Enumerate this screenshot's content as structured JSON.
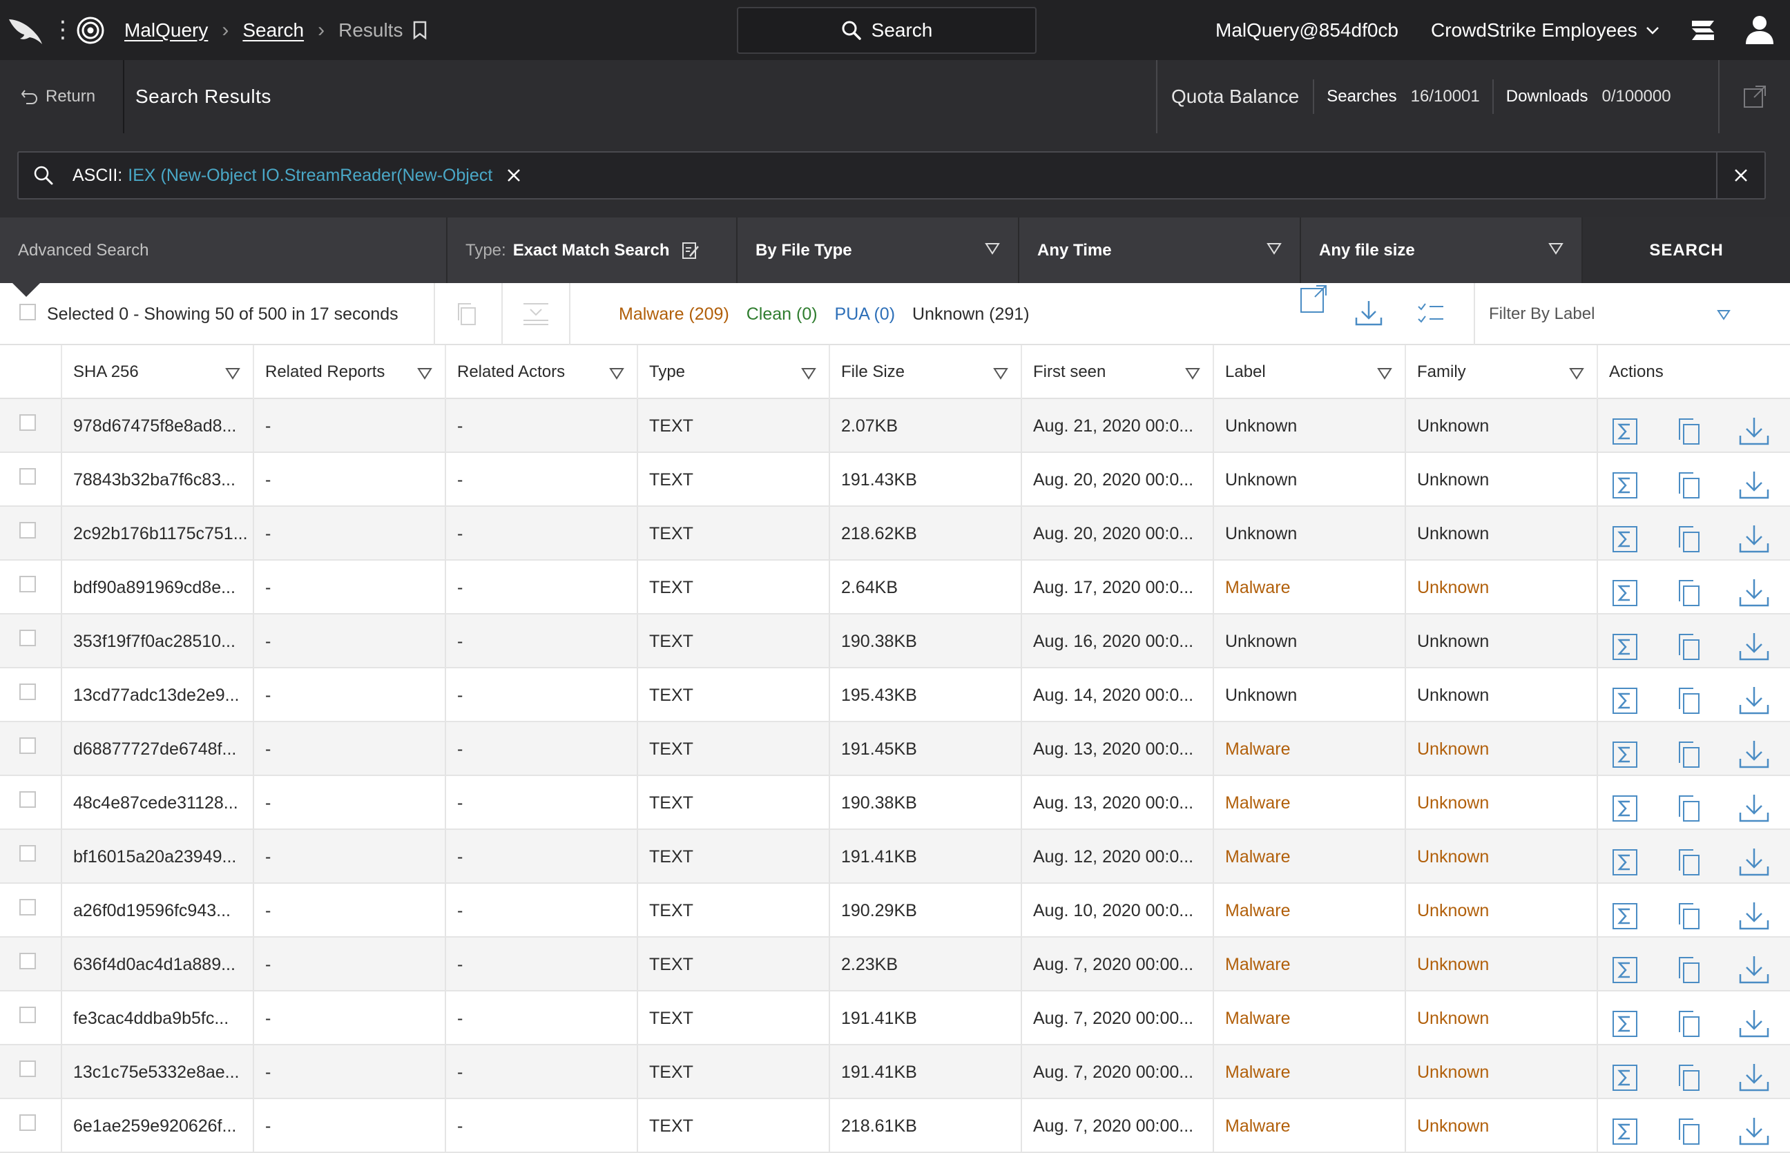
{
  "topbar": {
    "crumbs": [
      "MalQuery",
      "Search",
      "Results"
    ],
    "search_label": "Search",
    "user": "MalQuery@854df0cb",
    "org": "CrowdStrike Employees"
  },
  "subbar": {
    "return_label": "Return",
    "title": "Search Results",
    "quota_label": "Quota Balance",
    "searches_label": "Searches",
    "searches_value": "16/10001",
    "downloads_label": "Downloads",
    "downloads_value": "0/100000"
  },
  "query": {
    "prefix": "ASCII:",
    "value": "IEX (New-Object IO.StreamReader(New-Object"
  },
  "filters": {
    "advanced": "Advanced Search",
    "type_label": "Type:",
    "type_value": "Exact Match Search",
    "file_type": "By File Type",
    "time": "Any Time",
    "size": "Any file size",
    "search_button": "SEARCH"
  },
  "status": {
    "summary": "Selected 0 - Showing 50 of 500 in 17 seconds",
    "malware": "Malware (209)",
    "clean": "Clean (0)",
    "pua": "PUA (0)",
    "unknown": "Unknown (291)",
    "filter_label": "Filter By Label"
  },
  "columns": [
    "SHA 256",
    "Related Reports",
    "Related Actors",
    "Type",
    "File Size",
    "First seen",
    "Label",
    "Family",
    "Actions"
  ],
  "rows": [
    {
      "sha": "978d67475f8e8ad8...",
      "reports": "-",
      "actors": "-",
      "type": "TEXT",
      "size": "2.07KB",
      "seen": "Aug. 21, 2020 00:0...",
      "label": "Unknown",
      "family": "Unknown",
      "malware": false
    },
    {
      "sha": "78843b32ba7f6c83...",
      "reports": "-",
      "actors": "-",
      "type": "TEXT",
      "size": "191.43KB",
      "seen": "Aug. 20, 2020 00:0...",
      "label": "Unknown",
      "family": "Unknown",
      "malware": false
    },
    {
      "sha": "2c92b176b1175c751...",
      "reports": "-",
      "actors": "-",
      "type": "TEXT",
      "size": "218.62KB",
      "seen": "Aug. 20, 2020 00:0...",
      "label": "Unknown",
      "family": "Unknown",
      "malware": false
    },
    {
      "sha": "bdf90a891969cd8e...",
      "reports": "-",
      "actors": "-",
      "type": "TEXT",
      "size": "2.64KB",
      "seen": "Aug. 17, 2020 00:0...",
      "label": "Malware",
      "family": "Unknown",
      "malware": true
    },
    {
      "sha": "353f19f7f0ac28510...",
      "reports": "-",
      "actors": "-",
      "type": "TEXT",
      "size": "190.38KB",
      "seen": "Aug. 16, 2020 00:0...",
      "label": "Unknown",
      "family": "Unknown",
      "malware": false
    },
    {
      "sha": "13cd77adc13de2e9...",
      "reports": "-",
      "actors": "-",
      "type": "TEXT",
      "size": "195.43KB",
      "seen": "Aug. 14, 2020 00:0...",
      "label": "Unknown",
      "family": "Unknown",
      "malware": false
    },
    {
      "sha": "d68877727de6748f...",
      "reports": "-",
      "actors": "-",
      "type": "TEXT",
      "size": "191.45KB",
      "seen": "Aug. 13, 2020 00:0...",
      "label": "Malware",
      "family": "Unknown",
      "malware": true
    },
    {
      "sha": "48c4e87cede31128...",
      "reports": "-",
      "actors": "-",
      "type": "TEXT",
      "size": "190.38KB",
      "seen": "Aug. 13, 2020 00:0...",
      "label": "Malware",
      "family": "Unknown",
      "malware": true
    },
    {
      "sha": "bf16015a20a23949...",
      "reports": "-",
      "actors": "-",
      "type": "TEXT",
      "size": "191.41KB",
      "seen": "Aug. 12, 2020 00:0...",
      "label": "Malware",
      "family": "Unknown",
      "malware": true
    },
    {
      "sha": "a26f0d19596fc943...",
      "reports": "-",
      "actors": "-",
      "type": "TEXT",
      "size": "190.29KB",
      "seen": "Aug. 10, 2020 00:0...",
      "label": "Malware",
      "family": "Unknown",
      "malware": true
    },
    {
      "sha": "636f4d0ac4d1a889...",
      "reports": "-",
      "actors": "-",
      "type": "TEXT",
      "size": "2.23KB",
      "seen": "Aug. 7, 2020 00:00...",
      "label": "Malware",
      "family": "Unknown",
      "malware": true
    },
    {
      "sha": "fe3cac4ddba9b5fc...",
      "reports": "-",
      "actors": "-",
      "type": "TEXT",
      "size": "191.41KB",
      "seen": "Aug. 7, 2020 00:00...",
      "label": "Malware",
      "family": "Unknown",
      "malware": true
    },
    {
      "sha": "13c1c75e5332e8ae...",
      "reports": "-",
      "actors": "-",
      "type": "TEXT",
      "size": "191.41KB",
      "seen": "Aug. 7, 2020 00:00...",
      "label": "Malware",
      "family": "Unknown",
      "malware": true
    },
    {
      "sha": "6e1ae259e920626f...",
      "reports": "-",
      "actors": "-",
      "type": "TEXT",
      "size": "218.61KB",
      "seen": "Aug. 7, 2020 00:00...",
      "label": "Malware",
      "family": "Unknown",
      "malware": true
    }
  ],
  "icons": {
    "falcon": "falcon-logo-icon",
    "brand": "malquery-target-icon",
    "bookmark": "bookmark-icon",
    "search": "search-icon",
    "chevron": "chevron-down-icon",
    "layers": "stack-icon",
    "user": "user-icon",
    "return": "return-arrow-icon",
    "export": "export-icon",
    "close": "close-icon",
    "edit": "edit-icon",
    "filter": "filter-triangle-icon",
    "copy": "copy-icon",
    "download": "download-icon",
    "checklist": "checklist-icon",
    "analyze": "sigma-report-icon"
  },
  "colors": {
    "malware": "#b15f0a",
    "clean": "#2f7d2f",
    "pua": "#2d6fb8",
    "accent": "#4aa8c7",
    "topbar": "#222224"
  }
}
